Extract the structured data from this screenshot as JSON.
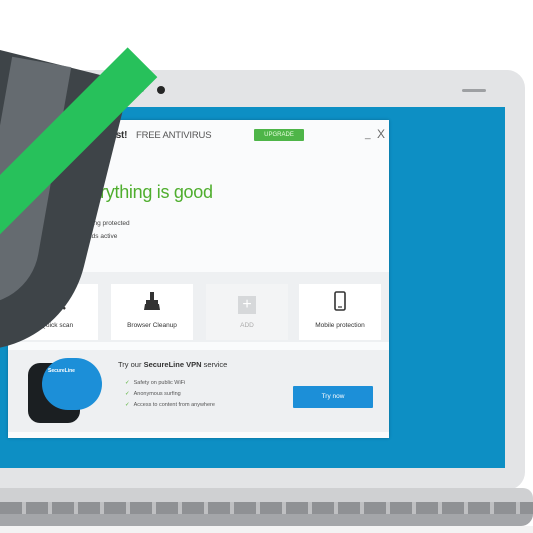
{
  "app": {
    "brand": "avast!",
    "product": "FREE ANTIVIRUS",
    "upgrade_badge": "UPGRADE",
    "minimize": "_",
    "close": "X"
  },
  "status": {
    "title": "Everything is good",
    "line1": "Everything protected",
    "line2": "all shields active"
  },
  "tiles": [
    {
      "label": "Quick scan",
      "icon": "search-icon",
      "glyph": "⚲"
    },
    {
      "label": "Browser Cleanup",
      "icon": "broom-icon",
      "glyph": "♜"
    },
    {
      "label": "ADD",
      "icon": "add-icon",
      "glyph": "+"
    },
    {
      "label": "Mobile protection",
      "icon": "phone-icon",
      "glyph": "▯"
    }
  ],
  "promo": {
    "art_label": "SecureLine",
    "head_prefix": "Try our ",
    "head_product": "SecureLine VPN",
    "head_suffix": " service",
    "features": [
      "Safety on public WiFi",
      "Anonymous surfing",
      "Access to content from anywhere"
    ],
    "tick": "✓",
    "button": "Try now"
  },
  "colors": {
    "accent_green": "#4fae2e",
    "accent_blue": "#1c8fd8",
    "brand_orange": "#f47b20",
    "screen_blue": "#0d8fc4"
  }
}
